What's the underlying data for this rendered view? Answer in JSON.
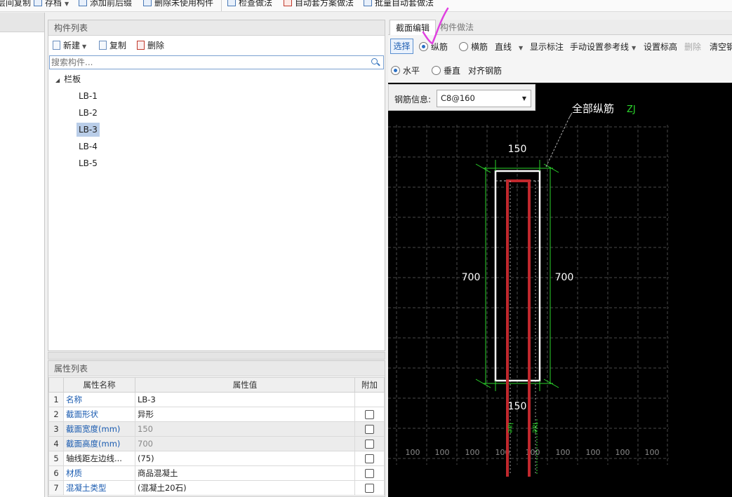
{
  "toolbar": {
    "items": [
      "层间复制",
      "存档",
      "添加前后缀",
      "删除未使用构件",
      "检查做法",
      "自动套方案做法",
      "批量自动套做法"
    ]
  },
  "component_list": {
    "title": "构件列表",
    "new_label": "新建",
    "copy_label": "复制",
    "delete_label": "删除",
    "search_placeholder": "搜索构件...",
    "root_label": "栏板",
    "items": [
      "LB-1",
      "LB-2",
      "LB-3",
      "LB-4",
      "LB-5"
    ],
    "selected": "LB-3"
  },
  "property_list": {
    "title": "属性列表",
    "headers": [
      "属性名称",
      "属性值",
      "附加"
    ],
    "rows": [
      {
        "num": "1",
        "name": "名称",
        "value": "LB-3"
      },
      {
        "num": "2",
        "name": "截面形状",
        "value": "异形"
      },
      {
        "num": "3",
        "name": "截面宽度(mm)",
        "value": "150"
      },
      {
        "num": "4",
        "name": "截面高度(mm)",
        "value": "700"
      },
      {
        "num": "5",
        "name": "轴线距左边线...",
        "value": "(75)"
      },
      {
        "num": "6",
        "name": "材质",
        "value": "商品混凝土"
      },
      {
        "num": "7",
        "name": "混凝土类型",
        "value": "(混凝土20石)"
      }
    ]
  },
  "editor": {
    "tab_section": "截面编辑",
    "tab_method": "构件做法",
    "select_label": "选择",
    "radio_long": "纵筋",
    "radio_trans": "横筋",
    "line_label": "直线",
    "show_dim": "显示标注",
    "manual_ref": "手动设置参考线",
    "set_elev": "设置标高",
    "delete": "删除",
    "clear": "清空钢",
    "radio_h": "水平",
    "radio_v": "垂直",
    "align": "对齐钢筋",
    "rebar_info_label": "钢筋信息:",
    "rebar_info_value": "C8@160"
  },
  "drawing": {
    "annotation": "全部纵筋",
    "annotation_code": "ZJ",
    "dim_top": "150",
    "dim_bottom": "150",
    "dim_left": "700",
    "dim_right": "700",
    "lae_left": "lae",
    "lae_right": "lae",
    "grid_label": "100",
    "colors": {
      "background": "#000000",
      "rebar": "#c0282d",
      "dimension": "#2bd42b",
      "grid": "#5a5a5a",
      "outline": "#ffffff",
      "annotation_mark": "#e040e0"
    }
  }
}
